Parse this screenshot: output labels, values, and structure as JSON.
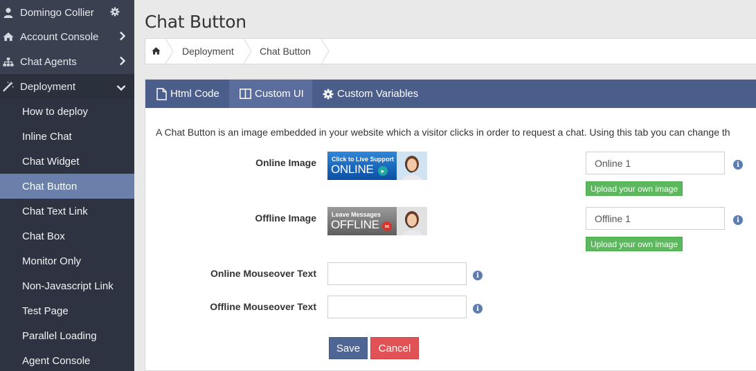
{
  "sidebar": {
    "user": "Domingo Collier",
    "items": [
      {
        "label": "Account Console"
      },
      {
        "label": "Chat Agents"
      },
      {
        "label": "Deployment"
      }
    ],
    "subitems": [
      {
        "label": "How to deploy"
      },
      {
        "label": "Inline Chat"
      },
      {
        "label": "Chat Widget"
      },
      {
        "label": "Chat Button"
      },
      {
        "label": "Chat Text Link"
      },
      {
        "label": "Chat Box"
      },
      {
        "label": "Monitor Only"
      },
      {
        "label": "Non-Javascript Link"
      },
      {
        "label": "Test Page"
      },
      {
        "label": "Parallel Loading"
      },
      {
        "label": "Agent Console"
      }
    ]
  },
  "page": {
    "title": "Chat Button"
  },
  "breadcrumb": {
    "items": [
      "Deployment",
      "Chat Button"
    ]
  },
  "tabs": [
    {
      "label": "Html Code"
    },
    {
      "label": "Custom UI"
    },
    {
      "label": "Custom Variables"
    }
  ],
  "form": {
    "description": "A Chat Button is an image embedded in your website which a visitor clicks in order to request a chat. Using this tab you can change th",
    "online_image_label": "Online Image",
    "offline_image_label": "Offline Image",
    "online_banner": {
      "line1": "Click to Live Support",
      "line2": "ONLINE"
    },
    "offline_banner": {
      "line1": "Leave Messages",
      "line2": "OFFLINE"
    },
    "online_select_value": "Online 1",
    "offline_select_value": "Offline 1",
    "upload_label": "Upload your own image",
    "online_mouseover_label": "Online Mouseover Text",
    "offline_mouseover_label": "Offline Mouseover Text",
    "online_mouseover_value": "",
    "offline_mouseover_value": "",
    "save_label": "Save",
    "cancel_label": "Cancel"
  },
  "colors": {
    "sidebar_bg": "#394150",
    "sidebar_active": "#6a7fa9",
    "tabbar_bg": "#4a5d8b",
    "upload_green": "#5cb85c",
    "save_blue": "#4f6594",
    "cancel_red": "#e05255"
  }
}
